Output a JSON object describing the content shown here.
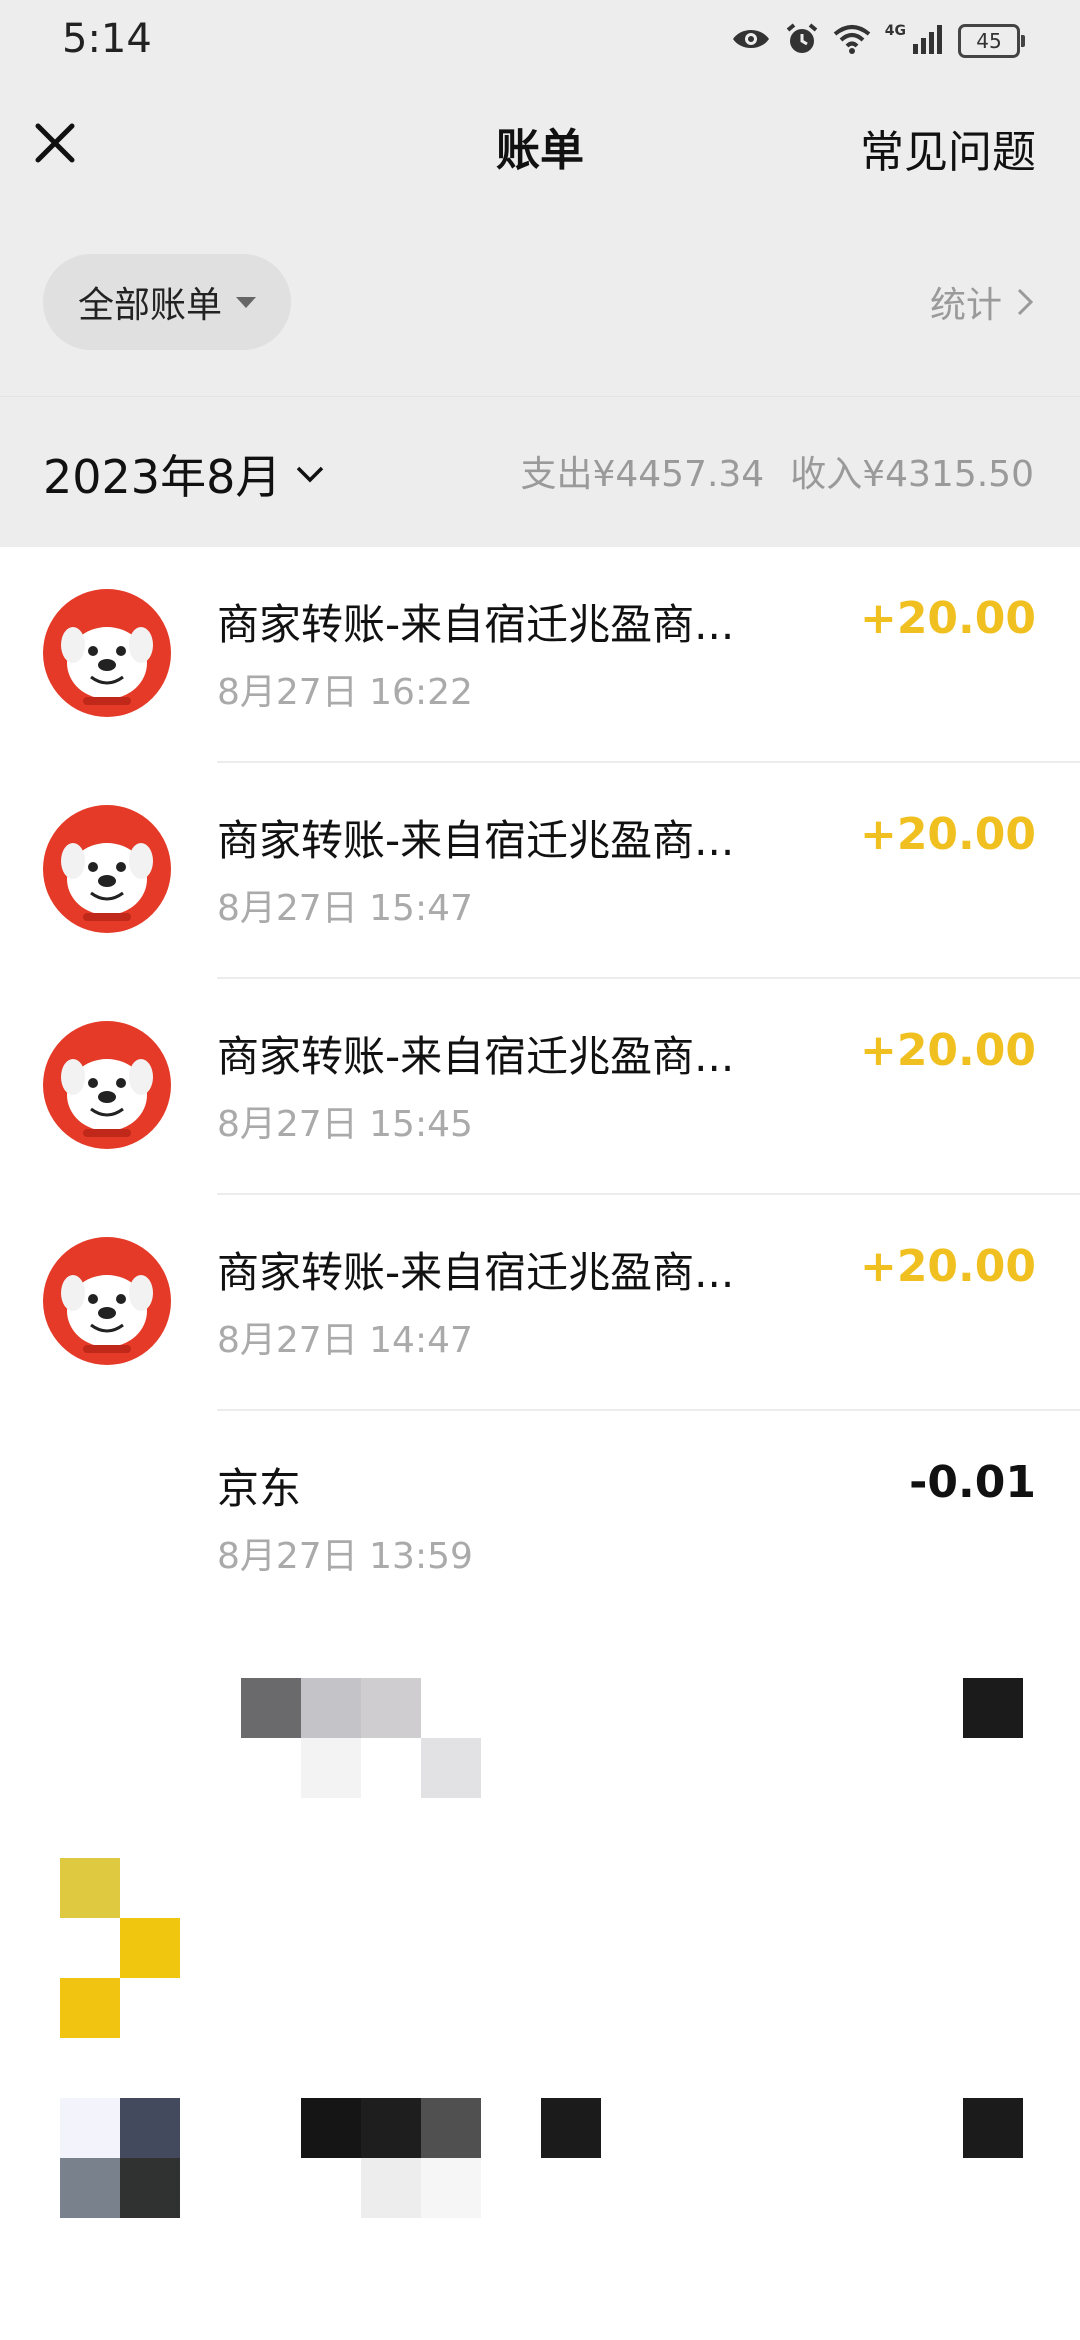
{
  "status_bar": {
    "time": "5:14",
    "network": "4G",
    "battery": "45"
  },
  "nav": {
    "title": "账单",
    "faq": "常见问题",
    "close_icon": "close-icon"
  },
  "filter": {
    "label": "全部账单",
    "stats": "统计"
  },
  "month_bar": {
    "month": "2023年8月",
    "expense": "支出¥4457.34",
    "income": "收入¥4315.50"
  },
  "transactions": [
    {
      "title": "商家转账-来自宿迁兆盈商...",
      "time": "8月27日 16:22",
      "amount": "+20.00",
      "type": "income"
    },
    {
      "title": "商家转账-来自宿迁兆盈商...",
      "time": "8月27日 15:47",
      "amount": "+20.00",
      "type": "income"
    },
    {
      "title": "商家转账-来自宿迁兆盈商...",
      "time": "8月27日 15:45",
      "amount": "+20.00",
      "type": "income"
    },
    {
      "title": "商家转账-来自宿迁兆盈商...",
      "time": "8月27日 14:47",
      "amount": "+20.00",
      "type": "income"
    },
    {
      "title": "京东",
      "time": "8月27日 13:59",
      "amount": "-0.01",
      "type": "expense"
    }
  ],
  "colors": {
    "income": "#f0c020",
    "avatar_bg": "#e53a28",
    "header_bg": "#ededed"
  }
}
